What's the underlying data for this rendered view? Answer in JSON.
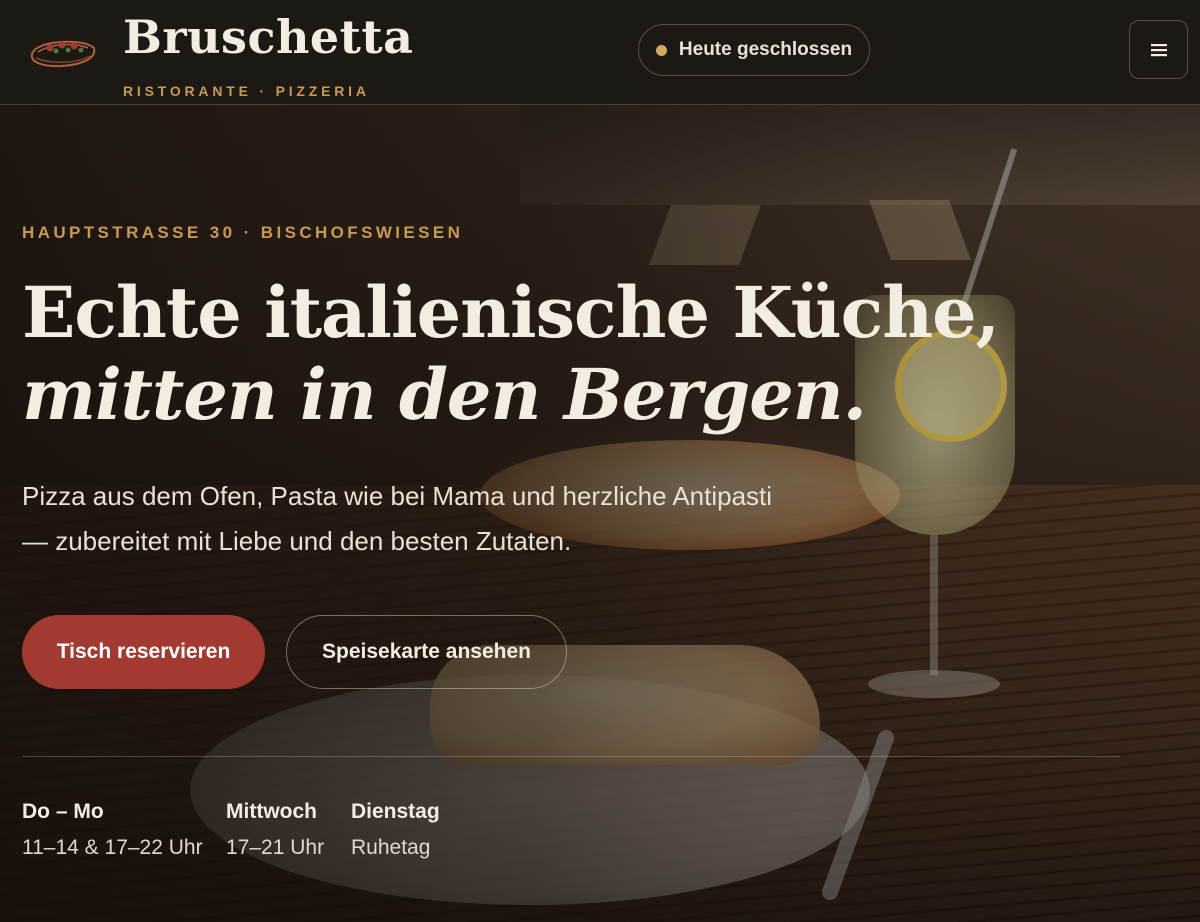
{
  "header": {
    "brand_name": "Bruschetta",
    "brand_sub": "RISTORANTE · PIZZERIA",
    "status_text": "Heute geschlossen",
    "menu_icon": "hamburger-menu-icon",
    "logo_icon": "bruschetta-logo-icon"
  },
  "hero": {
    "eyebrow": "HAUPTSTRASSE 30 · BISCHOFSWIESEN",
    "headline_line1": "Echte italienische Küche,",
    "headline_line2": "mitten in den Bergen.",
    "lede": "Pizza aus dem Ofen, Pasta wie bei Mama und herzliche Antipasti — zubereitet mit Liebe und den besten Zutaten.",
    "primary_button": "Tisch reservieren",
    "secondary_button": "Speisekarte ansehen"
  },
  "hours": [
    {
      "day": "Do – Mo",
      "time": "11–14 & 17–22 Uhr"
    },
    {
      "day": "Mittwoch",
      "time": "17–21 Uhr"
    },
    {
      "day": "Dienstag",
      "time": "Ruhetag"
    }
  ],
  "colors": {
    "accent_gold": "#c79a52",
    "primary_red": "#a33a32",
    "header_bg": "#1c1813",
    "text_light": "#f3ece1",
    "status_dot": "#d6a85a"
  }
}
